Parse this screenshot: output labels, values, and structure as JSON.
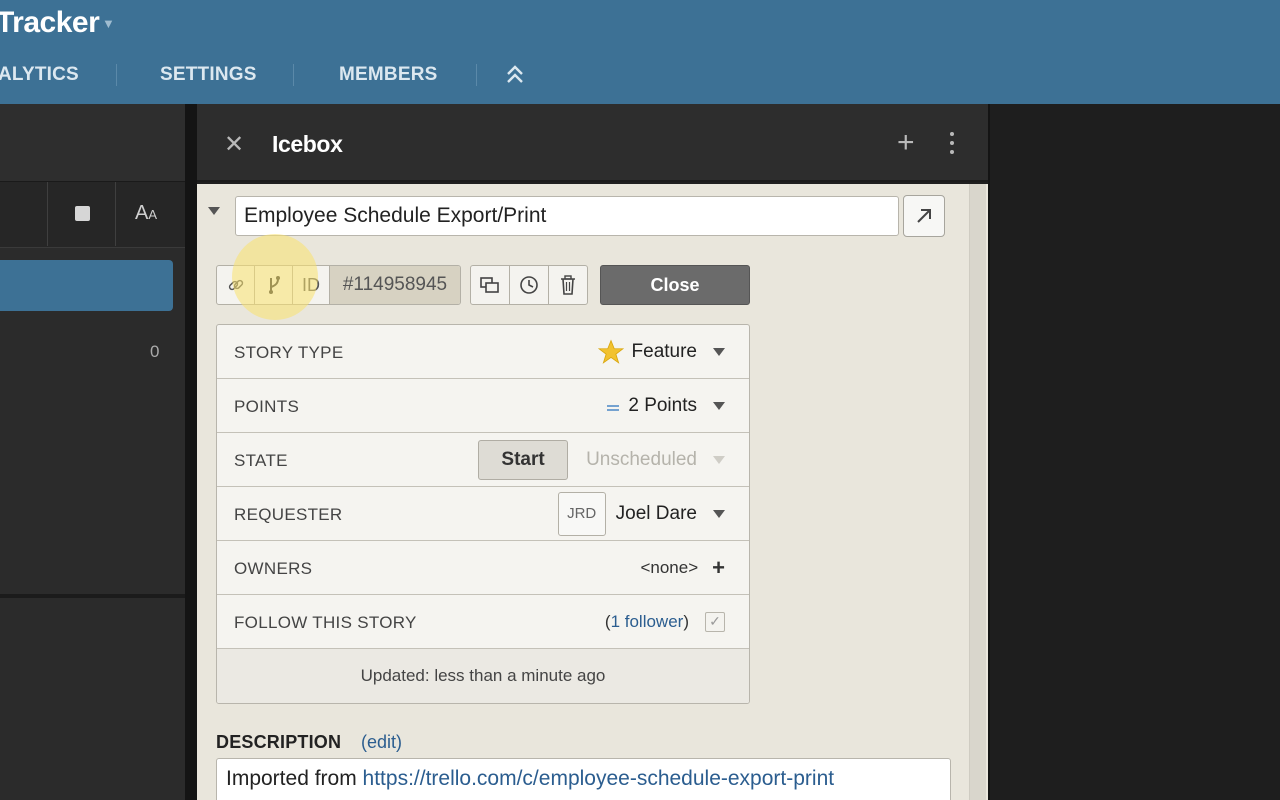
{
  "header": {
    "app_title": "Tracker",
    "nav": [
      "ALYTICS",
      "SETTINGS",
      "MEMBERS"
    ]
  },
  "left_panel": {
    "count": "0"
  },
  "icebox": {
    "title": "Icebox"
  },
  "story": {
    "title": "Employee Schedule Export/Print",
    "id_label": "ID",
    "id_value": "#114958945",
    "close_label": "Close",
    "rows": {
      "story_type": {
        "label": "STORY TYPE",
        "value": "Feature"
      },
      "points": {
        "label": "POINTS",
        "value": "2 Points"
      },
      "state": {
        "label": "STATE",
        "start_label": "Start",
        "value": "Unscheduled"
      },
      "requester": {
        "label": "REQUESTER",
        "initials": "JRD",
        "value": "Joel Dare"
      },
      "owners": {
        "label": "OWNERS",
        "value": "<none>"
      },
      "follow": {
        "label": "FOLLOW THIS STORY",
        "paren_open": "(",
        "followers": "1 follower",
        "paren_close": ")"
      }
    },
    "updated": "Updated: less than a minute ago",
    "description": {
      "label": "DESCRIPTION",
      "edit": "(edit)",
      "prefix": "Imported from ",
      "link": "https://trello.com/c/employee-schedule-export-print"
    }
  },
  "colors": {
    "header_blue": "#3d7195",
    "panel_bg": "#e9e6dc",
    "link": "#2b5d8f",
    "star": "#f2c230"
  }
}
